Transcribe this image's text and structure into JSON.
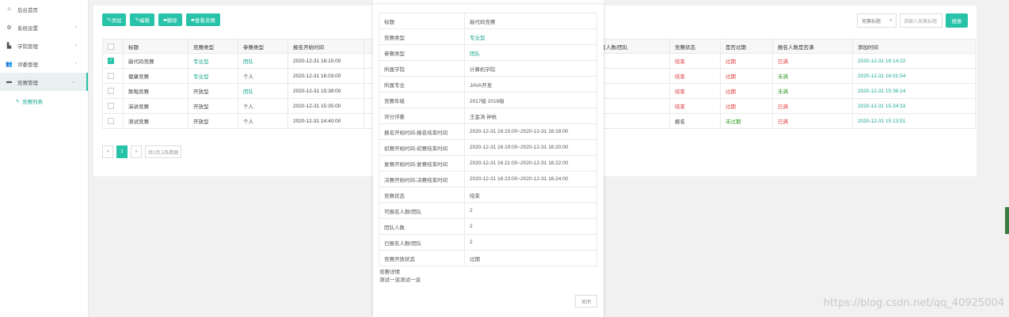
{
  "sidebar": {
    "items": [
      {
        "label": "后台首页",
        "icon": "home-icon"
      },
      {
        "label": "系统设置",
        "icon": "gear-icon"
      },
      {
        "label": "学院管理",
        "icon": "building-icon"
      },
      {
        "label": "评委管理",
        "icon": "users-icon"
      },
      {
        "label": "竞赛管理",
        "icon": "gamepad-icon"
      }
    ],
    "sub_items": [
      {
        "label": "竞赛列表",
        "icon": "list-icon"
      }
    ]
  },
  "toolbar": {
    "add_label": "添加",
    "edit_label": "编辑",
    "delete_label": "删除",
    "view_label": "查看竞赛"
  },
  "search": {
    "select_value": "竞赛标题",
    "placeholder": "请输入竞赛标题",
    "button_label": "搜索"
  },
  "table": {
    "headers": [
      "",
      "标题",
      "竞赛类型",
      "参赛类型",
      "报名开始时间",
      "",
      "报名人数/团队",
      "竞赛状态",
      "是否过期",
      "报名人数是否满",
      "添加时间"
    ],
    "rows": [
      {
        "checked": true,
        "title": "敲代码竞赛",
        "type": "专业型",
        "team": "团队",
        "start": "2020-12-31 16:15:00",
        "status": "结束",
        "expired": "过期",
        "full": "已满",
        "added": "2020-12-31 16:14:22"
      },
      {
        "checked": false,
        "title": "健康竞赛",
        "type": "专业型",
        "team": "个人",
        "start": "2020-12-31 16:03:00",
        "status": "结束",
        "expired": "过期",
        "full": "未满",
        "added": "2020-12-31 16:01:54"
      },
      {
        "checked": false,
        "title": "歌唱竞赛",
        "type": "开放型",
        "team": "团队",
        "start": "2020-12-31 15:38:00",
        "status": "结束",
        "expired": "过期",
        "full": "未满",
        "added": "2020-12-31 15:36:14"
      },
      {
        "checked": false,
        "title": "演讲竞赛",
        "type": "开放型",
        "team": "个人",
        "start": "2020-12-31 15:35:00",
        "status": "结束",
        "expired": "过期",
        "full": "已满",
        "added": "2020-12-31 15:34:33"
      },
      {
        "checked": false,
        "title": "测试竞赛",
        "type": "开放型",
        "team": "个人",
        "start": "2020-12-31 14:40:00",
        "status": "报名",
        "expired": "未过期",
        "full": "已满",
        "added": "2020-12-31 15:13:51"
      }
    ]
  },
  "pager": {
    "prev": "«",
    "current": "1",
    "next": "»",
    "summary": "共1页,5条数据"
  },
  "modal": {
    "fields": [
      {
        "k": "标题",
        "v": "敲代码竞赛"
      },
      {
        "k": "竞赛类型",
        "v": "专业型"
      },
      {
        "k": "参赛类型",
        "v": "团队"
      },
      {
        "k": "所属学院",
        "v": "计算机学院"
      },
      {
        "k": "所属专业",
        "v": "JAVA开发"
      },
      {
        "k": "竞赛年级",
        "v": "2017级 2018级"
      },
      {
        "k": "评分评委",
        "v": "王金涛 钟杭"
      },
      {
        "k": "报名开始时间-报名结束时间",
        "v": "2020-12-31 16:15:00~2020-12-31 16:18:00"
      },
      {
        "k": "初赛开始时间-初赛结束时间",
        "v": "2020-12-31 16:19:00~2020-12-31 16:20:00"
      },
      {
        "k": "复赛开始时间-复赛结束时间",
        "v": "2020-12-31 16:21:00~2020-12-31 16:22:00"
      },
      {
        "k": "决赛开始时间-决赛结束时间",
        "v": "2020-12-31 16:23:00~2020-12-31 16:24:00"
      },
      {
        "k": "竞赛状态",
        "v": "结束"
      },
      {
        "k": "可报名人数/团队",
        "v": "2"
      },
      {
        "k": "团队人数",
        "v": "2"
      },
      {
        "k": "已报名人数/团队",
        "v": "2"
      },
      {
        "k": "竞赛开放状态",
        "v": "过期"
      }
    ],
    "desc_label": "竞赛详情",
    "desc": "测试一谈测试一谈",
    "close_label": "关闭"
  },
  "watermark": "https://blog.csdn.net/qq_40925004",
  "colors": {
    "accent": "#27c2a8",
    "red": "#e43b3b",
    "green": "#2f9b22"
  }
}
